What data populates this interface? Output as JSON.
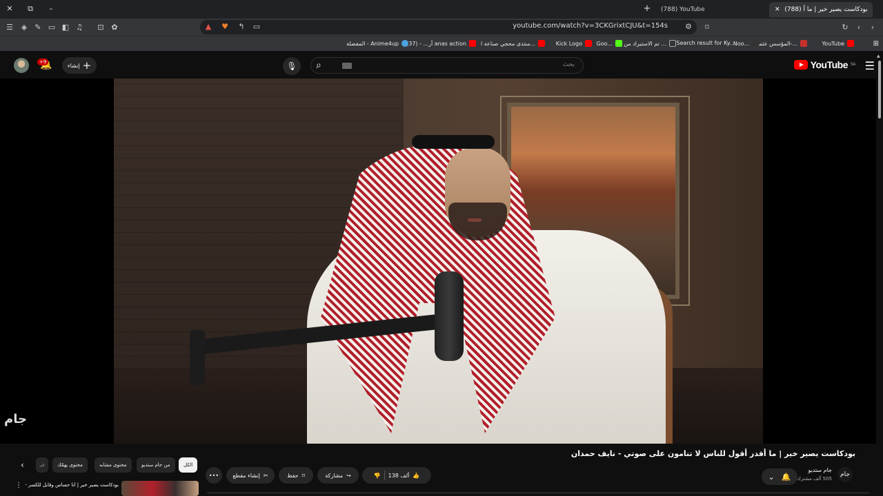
{
  "browser": {
    "tabs": [
      {
        "title": "(788) YouTube",
        "active": false
      },
      {
        "title": "(788) بودكاست يصير خير | ما أ",
        "active": true
      }
    ],
    "url": "youtube.com/watch?v=3CKGrixtCJU&t=154s",
    "window_controls": {
      "close": "✕",
      "restore": "⧉",
      "minimize": "–"
    },
    "new_tab": "+",
    "bookmarks": [
      {
        "label": "YouTube",
        "color": "#ff0000"
      },
      {
        "label": "المؤسس عثمان-...",
        "color": "#c4302b"
      },
      {
        "label": "Noo...",
        "color": "#333333"
      },
      {
        "label": "Search result for Ky...",
        "color": "#1a1a1a"
      },
      {
        "label": "تم الاستيراد من ...",
        "color": "#555555"
      },
      {
        "label": "Goo...",
        "color": "#53fc18"
      },
      {
        "label": "Kick Logo",
        "color": "#ff0000"
      },
      {
        "label": "منتدى محجي صناعة ا...",
        "color": "#ff0000"
      },
      {
        "label": "أر... - (37) anas action",
        "color": "#ff0000"
      },
      {
        "label": "المفضلة - Anime4up",
        "color": "#4aa3df"
      }
    ]
  },
  "youtube": {
    "logo_text": "YouTube",
    "logo_region": "SA",
    "search_placeholder": "بحث",
    "create_label": "إنشاء",
    "notifications_badge": "+9",
    "video": {
      "title": "بودكاست يصير خير | ما أقدر أقول للناس لا تنامون على صوتي - نايف حمدان",
      "channel_name": "جام ستديو",
      "channel_avatar_text": "جام",
      "subscribers": "505 ألف مشترك",
      "likes": "138 ألف",
      "share_label": "مشاركة",
      "save_label": "حفظ",
      "clip_label": "إنشاء مقطع",
      "more_label": "•••",
      "watermark": "جام"
    },
    "chips": [
      "الكل",
      "من جام ستديو",
      "محتوى مشابه",
      "محتوى يهمّك",
      "فيـ"
    ],
    "recommended": {
      "title": "بودكاست يصير خير | أنا حساس وقابل للكسر - محمد عبدالله حمد"
    }
  }
}
